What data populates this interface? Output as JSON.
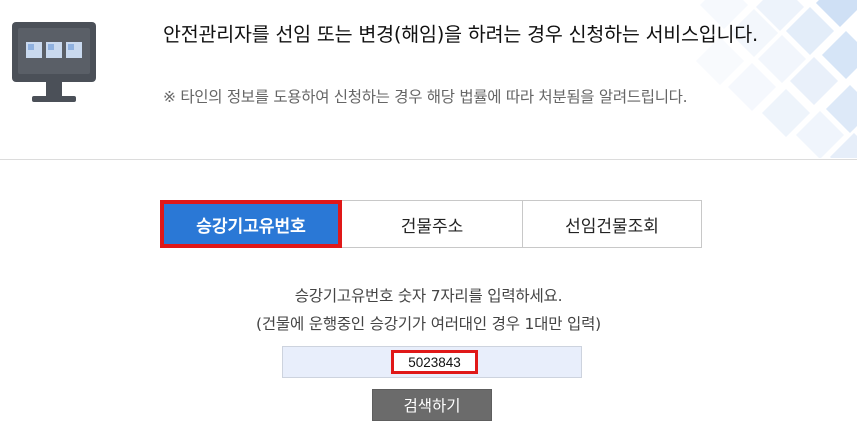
{
  "header": {
    "headline": "안전관리자를 선임 또는 변경(해임)을 하려는 경우 신청하는 서비스입니다.",
    "notice": "※ 타인의 정보를 도용하여 신청하는 경우 해당 법률에 따라 처분됨을 알려드립니다.",
    "icon": "monitor-icon"
  },
  "tabs": [
    {
      "label": "승강기고유번호",
      "active": true
    },
    {
      "label": "건물주소",
      "active": false
    },
    {
      "label": "선임건물조회",
      "active": false
    }
  ],
  "guide": {
    "line1": "승강기고유번호 숫자 7자리를 입력하세요.",
    "line2": "(건물에 운행중인 승강기가 여러대인 경우 1대만 입력)"
  },
  "search": {
    "value": "5023843",
    "button_label": "검색하기"
  },
  "colors": {
    "accent": "#2a78d6",
    "highlight": "#e01818",
    "button": "#6b6b6b",
    "input_bg": "#e8eefb"
  }
}
